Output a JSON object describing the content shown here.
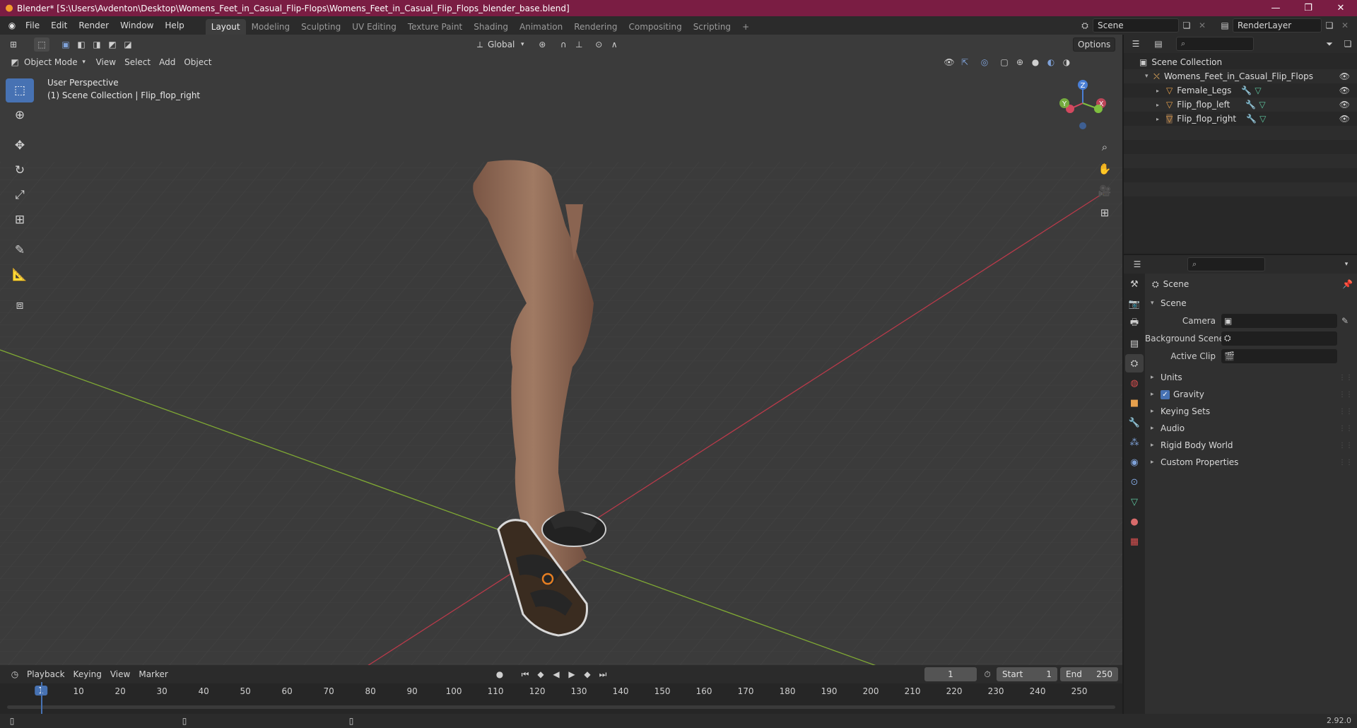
{
  "titlebar": {
    "title": "Blender* [S:\\Users\\Avdenton\\Desktop\\Womens_Feet_in_Casual_Flip-Flops\\Womens_Feet_in_Casual_Flip_Flops_blender_base.blend]",
    "minimize": "—",
    "maximize": "❐",
    "close": "✕"
  },
  "menu": [
    "File",
    "Edit",
    "Render",
    "Window",
    "Help"
  ],
  "workspaces": [
    "Layout",
    "Modeling",
    "Sculpting",
    "UV Editing",
    "Texture Paint",
    "Shading",
    "Animation",
    "Rendering",
    "Compositing",
    "Scripting"
  ],
  "workspace_add": "+",
  "scene_name": "Scene",
  "render_layer": "RenderLayer",
  "viewport_header": {
    "transform_orientation": "Global",
    "options": "Options",
    "mode": "Object Mode",
    "menus": [
      "View",
      "Select",
      "Add",
      "Object"
    ]
  },
  "viewport_info": {
    "perspective": "User Perspective",
    "collection": "(1) Scene Collection | Flip_flop_right"
  },
  "gizmo": {
    "z": "Z",
    "y": "Y",
    "x": "X"
  },
  "outliner": {
    "root": "Scene Collection",
    "collection": "Womens_Feet_in_Casual_Flip_Flops",
    "objects": [
      "Female_Legs",
      "Flip_flop_left",
      "Flip_flop_right"
    ]
  },
  "properties": {
    "header": "Scene",
    "panel": "Scene",
    "camera_label": "Camera",
    "bg_scene_label": "Background Scene",
    "active_clip_label": "Active Clip",
    "subpanels": [
      "Units",
      "Gravity",
      "Keying Sets",
      "Audio",
      "Rigid Body World",
      "Custom Properties"
    ]
  },
  "timeline": {
    "menus": [
      "Playback",
      "Keying",
      "View",
      "Marker"
    ],
    "current_frame": "1",
    "start_label": "Start",
    "start": "1",
    "end_label": "End",
    "end": "250",
    "ticks": [
      "1",
      "10",
      "20",
      "30",
      "40",
      "50",
      "60",
      "70",
      "80",
      "90",
      "100",
      "110",
      "120",
      "130",
      "140",
      "150",
      "160",
      "170",
      "180",
      "190",
      "200",
      "210",
      "220",
      "230",
      "240",
      "250"
    ]
  },
  "status": {
    "version": "2.92.0"
  },
  "colors": {
    "accent": "#4772b3",
    "titlebar": "#7a1d43",
    "x_axis": "#b83a4a",
    "y_axis": "#7fa834"
  }
}
